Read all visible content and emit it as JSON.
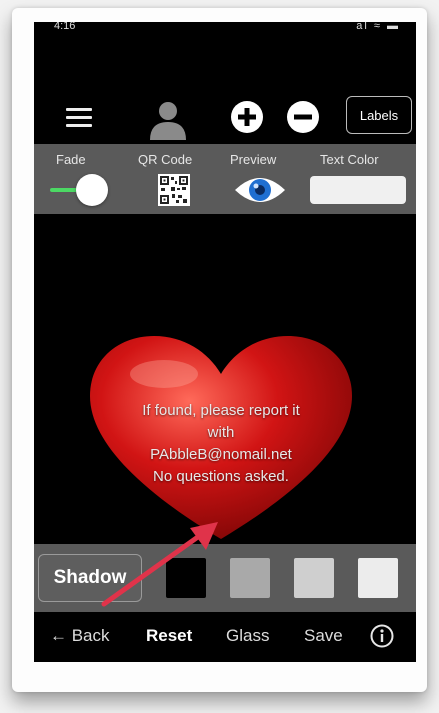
{
  "status_bar": {
    "time": "4:16",
    "indicators": "al ≈ ▬"
  },
  "toolbar": {
    "menu_icon": "hamburger-menu-icon",
    "avatar_icon": "person-icon",
    "plus_icon": "plus-circle-icon",
    "minus_icon": "minus-circle-icon",
    "labels_button": "Labels"
  },
  "options": {
    "fade_label": "Fade",
    "qr_label": "QR Code",
    "preview_label": "Preview",
    "text_color_label": "Text Color",
    "fade_enabled": true,
    "text_color_value": "#f0f0f0"
  },
  "canvas": {
    "lines": [
      "If found, please report it",
      "with",
      "PAbbleB@nomail.net",
      "No questions asked."
    ]
  },
  "shadow_bar": {
    "shadow_button": "Shadow",
    "swatches": [
      "#000000",
      "#a9a9a9",
      "#cfcfcf",
      "#ececec"
    ]
  },
  "bottom_bar": {
    "back": "← Back",
    "reset": "Reset",
    "glass": "Glass",
    "save": "Save",
    "info_icon": "info-circle-icon"
  },
  "colors": {
    "accent_toggle": "#4cd964",
    "arrow": "#e0334a",
    "heart": "#d11414"
  }
}
